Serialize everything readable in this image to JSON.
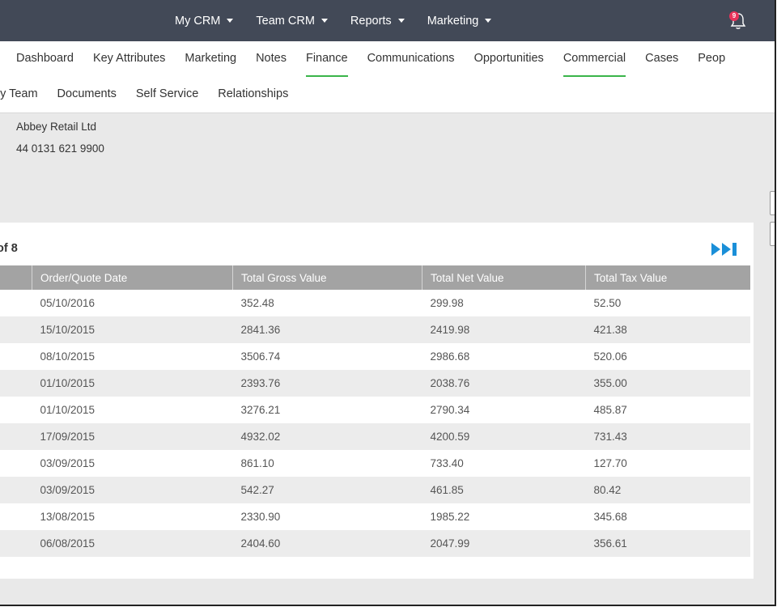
{
  "topnav": {
    "items": [
      {
        "label": "My CRM"
      },
      {
        "label": "Team CRM"
      },
      {
        "label": "Reports"
      },
      {
        "label": "Marketing"
      }
    ],
    "notifications_count": "9"
  },
  "tabs": {
    "row1": [
      "Dashboard",
      "Key Attributes",
      "Marketing",
      "Notes",
      "Finance",
      "Communications",
      "Opportunities",
      "Commercial",
      "Cases",
      "Peop"
    ],
    "row2": [
      "ny Team",
      "Documents",
      "Self Service",
      "Relationships"
    ],
    "active": [
      "Finance",
      "Commercial"
    ]
  },
  "account": {
    "name": "Abbey Retail Ltd",
    "phone": "44 0131 621 9900"
  },
  "pager": {
    "label": "of 8"
  },
  "table": {
    "headers": [
      "",
      "Order/Quote Date",
      "Total Gross Value",
      "Total Net Value",
      "Total Tax Value"
    ],
    "rows": [
      [
        "05/10/2016",
        "352.48",
        "299.98",
        "52.50"
      ],
      [
        "15/10/2015",
        "2841.36",
        "2419.98",
        "421.38"
      ],
      [
        "08/10/2015",
        "3506.74",
        "2986.68",
        "520.06"
      ],
      [
        "01/10/2015",
        "2393.76",
        "2038.76",
        "355.00"
      ],
      [
        "01/10/2015",
        "3276.21",
        "2790.34",
        "485.87"
      ],
      [
        "17/09/2015",
        "4932.02",
        "4200.59",
        "731.43"
      ],
      [
        "03/09/2015",
        "861.10",
        "733.40",
        "127.70"
      ],
      [
        "03/09/2015",
        "542.27",
        "461.85",
        "80.42"
      ],
      [
        "13/08/2015",
        "2330.90",
        "1985.22",
        "345.68"
      ],
      [
        "06/08/2015",
        "2404.60",
        "2047.99",
        "356.61"
      ]
    ]
  },
  "colors": {
    "topbar": "#424957",
    "active_tab": "#3ab54a",
    "badge": "#e8335a",
    "header": "#a3a3a3",
    "pager_icon": "#1a8fd8"
  },
  "icons": {
    "bell": "bell-icon",
    "last_page": "skip-to-end-icon"
  }
}
